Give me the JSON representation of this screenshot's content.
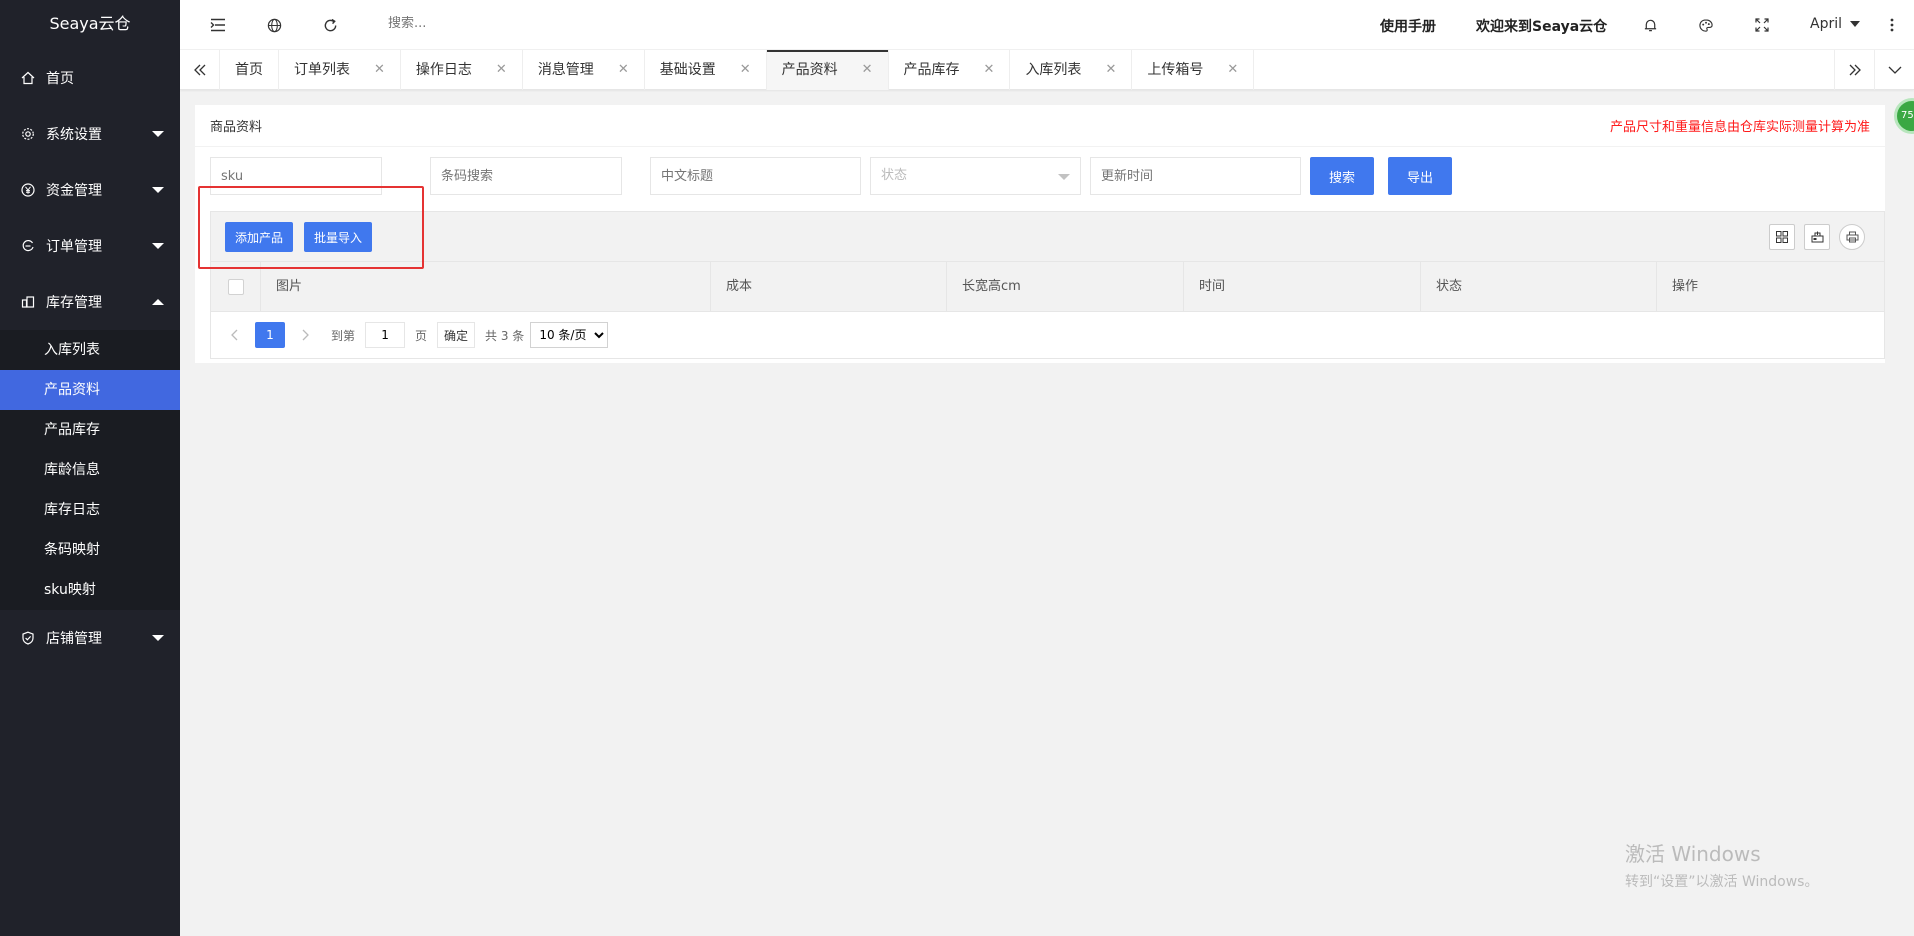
{
  "app": {
    "title": "Seaya云仓"
  },
  "sidebar": {
    "items": [
      {
        "label": "首页",
        "icon": "home-icon"
      },
      {
        "label": "系统设置",
        "icon": "gear-icon"
      },
      {
        "label": "资金管理",
        "icon": "yen-icon"
      },
      {
        "label": "订单管理",
        "icon": "order-icon"
      },
      {
        "label": "库存管理",
        "icon": "inventory-icon"
      },
      {
        "label": "店铺管理",
        "icon": "shield-icon"
      }
    ],
    "sub_items": [
      "入库列表",
      "产品资料",
      "产品库存",
      "库龄信息",
      "库存日志",
      "条码映射",
      "sku映射"
    ]
  },
  "header": {
    "search_placeholder": "搜索...",
    "manual": "使用手册",
    "welcome": "欢迎来到Seaya云仓",
    "user": "April"
  },
  "tabs": [
    "首页",
    "订单列表",
    "操作日志",
    "消息管理",
    "基础设置",
    "产品资料",
    "产品库存",
    "入库列表",
    "上传箱号"
  ],
  "card": {
    "title": "商品资料",
    "note": "产品尺寸和重量信息由仓库实际测量计算为准"
  },
  "filters": {
    "sku": "sku",
    "barcode": "条码搜索",
    "cn_title": "中文标题",
    "status": "状态",
    "update_time": "更新时间",
    "search_btn": "搜索",
    "export_btn": "导出"
  },
  "toolbar": {
    "add_btn": "添加产品",
    "import_btn": "批量导入"
  },
  "table": {
    "columns": [
      "图片",
      "成本",
      "长宽高cm",
      "时间",
      "状态",
      "操作"
    ]
  },
  "pager": {
    "current": "1",
    "goto_label": "到第",
    "goto_value": "1",
    "page_unit": "页",
    "confirm": "确定",
    "total": "共 3 条",
    "page_size": "10 条/页"
  },
  "badge": {
    "text": "75"
  },
  "watermark": {
    "title": "激活 Windows",
    "subtitle": "转到“设置”以激活 Windows。"
  }
}
